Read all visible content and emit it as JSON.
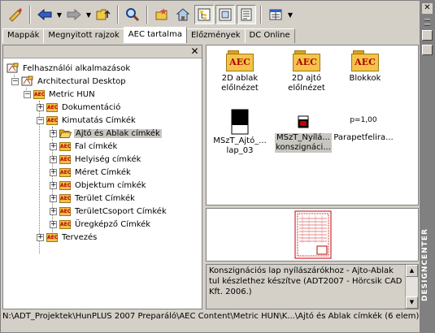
{
  "tabs": [
    "Mappák",
    "Megnyitott rajzok",
    "AEC tartalma",
    "Előzmények",
    "DC Online"
  ],
  "active_tab": 2,
  "tree": {
    "close_label": "✕",
    "nodes": [
      {
        "label": "Felhasználói alkalmazások",
        "icon": "app-icon",
        "expander": ""
      },
      {
        "label": "Architectural Desktop",
        "icon": "app-icon",
        "expander": "−"
      },
      {
        "label": "Metric HUN",
        "icon": "aec-folder-icon",
        "expander": "−"
      },
      {
        "label": "Dokumentáció",
        "icon": "aec-folder-icon",
        "expander": "+"
      },
      {
        "label": "Kimutatás Címkék",
        "icon": "aec-folder-icon",
        "expander": "−"
      },
      {
        "label": "Ajtó és Ablak címkék",
        "icon": "folder-open-icon",
        "expander": "+",
        "selected": true
      },
      {
        "label": "Fal címkék",
        "icon": "aec-folder-icon",
        "expander": "+"
      },
      {
        "label": "Helyiség címkék",
        "icon": "aec-folder-icon",
        "expander": "+"
      },
      {
        "label": "Méret Címkék",
        "icon": "aec-folder-icon",
        "expander": "+"
      },
      {
        "label": "Objektum címkék",
        "icon": "aec-folder-icon",
        "expander": "+"
      },
      {
        "label": "Terület Címkék",
        "icon": "aec-folder-icon",
        "expander": "+"
      },
      {
        "label": "TerületCsoport Címkék",
        "icon": "aec-folder-icon",
        "expander": "+"
      },
      {
        "label": "Üregképző Címkék",
        "icon": "aec-folder-icon",
        "expander": "+"
      },
      {
        "label": "Tervezés",
        "icon": "aec-folder-icon",
        "expander": "+"
      }
    ]
  },
  "content": {
    "aec_label": "AEC",
    "items": [
      {
        "label": "2D ablak\nelőlnézet",
        "icon": "aec-folder-icon"
      },
      {
        "label": "2D ajtó\nelőlnézet",
        "icon": "aec-folder-icon"
      },
      {
        "label": "Blokkok",
        "icon": "aec-folder-icon"
      },
      {
        "label": "MSzT_Ajtó_...\nlap_03",
        "icon": "drawing-block-icon"
      },
      {
        "label": "MSzT_Nyílá...\nkonszignáci...",
        "icon": "drawing-small-icon",
        "selected": true
      },
      {
        "label": "Parapetfelira...",
        "icon": "text-p-icon",
        "sub_text": "p=1,00"
      }
    ]
  },
  "description": "Konszignációs lap nyílászárókhoz - Ajto-Ablak tul készlethez készítve (ADT2007 - Hörcsik CAD Kft. 2006.)",
  "status": "N:\\ADT_Projektek\\HunPLUS 2007 Preparáló\\AEC Content\\Metric HUN\\K...\\Ajtó és Ablak címkék (6 elem)",
  "designcenter": {
    "title": "DESIGNCENTER",
    "close_label": "✕"
  },
  "colors": {
    "aec_folder": "#f2c44a",
    "aec_text": "#b00000",
    "selection": "#c8c6c0",
    "window_bg": "#d4d0c8"
  }
}
